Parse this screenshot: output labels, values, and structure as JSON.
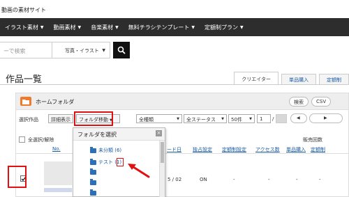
{
  "site": {
    "title": "動画の素材サイト"
  },
  "nav": {
    "items": [
      {
        "label": "イラスト素材"
      },
      {
        "label": "動画素材"
      },
      {
        "label": "音楽素材"
      },
      {
        "label": "無料チラシテンプレート"
      },
      {
        "label": "定額制プラン"
      }
    ]
  },
  "search": {
    "placeholder": "ーで検索",
    "category": "写真・イラスト"
  },
  "page": {
    "title": "作品一覧"
  },
  "tabs": [
    {
      "label": "クリエイター"
    },
    {
      "label": "単品購入"
    },
    {
      "label": "定額制"
    }
  ],
  "folder_bar": {
    "title": "ホームフォルダ",
    "search_label": "検索",
    "csv_label": "CSV"
  },
  "toolbar": {
    "select_label": "選択作品",
    "detail_button": "詳細表示",
    "move_button": "フォルダ移動",
    "type_filter": "全種類",
    "status_filter": "全ステータス",
    "per_page": "50件",
    "page_number": "1",
    "page_total": "/"
  },
  "table": {
    "select_all": "全選択/解除",
    "sales_group": "販売回数",
    "headers": {
      "no": "No.",
      "upload_date": "ード日",
      "exclusive": "独占設定",
      "fixed_rate_setting": "定額制設定",
      "access": "アクセス数",
      "single_purchase": "単品購入",
      "fixed_rate": "定額制"
    },
    "rows": [
      {
        "date": "5 / 02",
        "exclusive": "ON",
        "fixed_rate_setting": "-",
        "access": "-",
        "single_purchase": "-",
        "fixed_rate": "-"
      }
    ]
  },
  "dropdown": {
    "title": "フォルダを選択",
    "items": [
      {
        "label": "未分類 (6)"
      },
      {
        "label": "テスト (1)"
      },
      {
        "label": ""
      },
      {
        "label": ""
      },
      {
        "label": ""
      }
    ]
  },
  "colors": {
    "nav_bg": "#2d2d2d",
    "highlight": "#e01010",
    "link": "#1a5ba6",
    "folder": "#f07a2a"
  }
}
